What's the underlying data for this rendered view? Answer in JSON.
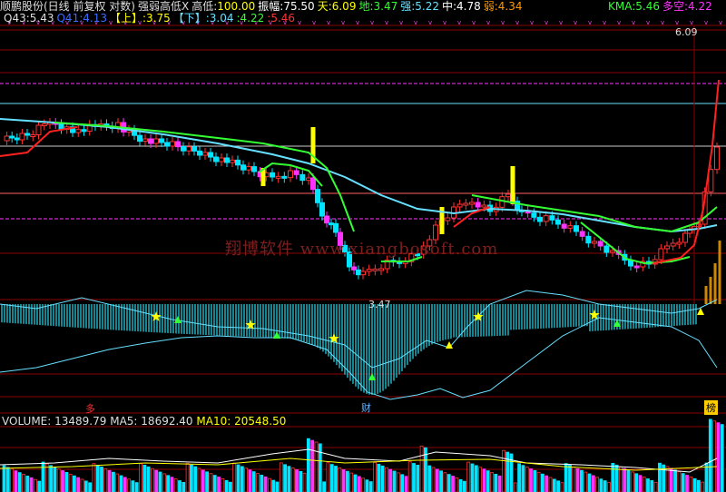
{
  "header1": {
    "name": "顺鹏股份(日线 前复权 对数)",
    "indicator": "强弱高低X",
    "gaodi_label": "高低:",
    "gaodi": "100.00",
    "zhenfu_label": "振幅:",
    "zhenfu": "75.50",
    "tian_label": "天:",
    "tian": "6.09",
    "di_label": "地:",
    "di": "3.47",
    "qiang_label": "强:",
    "qiang": "5.22",
    "zhong_label": "中:",
    "zhong": "4.78",
    "ruo_label": "弱:",
    "ruo": "4.34",
    "kma_label": "KMA:",
    "kma": "5.46",
    "duokong_label": "多空:",
    "duokong": "4.22"
  },
  "header2": {
    "q43_label": "Q43:",
    "q43": "5.43",
    "q41_label": "Q41:",
    "q41": "4.13",
    "up_label": "【上】:",
    "up": "3.75",
    "down_label": "【下】:",
    "down": "3.04",
    "v1_label": ":",
    "v1": "4.22",
    "v2_label": ":",
    "v2": "5.46"
  },
  "price_labels": {
    "high": "6.09",
    "low": "3.47"
  },
  "watermark": "翔博软件 www.xiangbosoft.com",
  "tags": {
    "left": "多",
    "middle": "财",
    "right": "榜"
  },
  "volume_header": {
    "volume_label": "VOLUME:",
    "volume": "13489.79",
    "ma5_label": "MA5:",
    "ma5": "18692.40",
    "ma10_label": "MA10:",
    "ma10": "20548.50"
  },
  "colors": {
    "up": "#ff3232",
    "down": "#00e5ff",
    "magenta": "#ff33ff",
    "yellow": "#ffff00",
    "green_line": "#33ff33",
    "cyan_line": "#66e0ff",
    "red_line": "#ff2020",
    "white_line": "#ffffff",
    "histogram": "#1fb0c0",
    "histogram_green": "#3cc35a",
    "volume_ma5": "#ffffff",
    "volume_ma10": "#ffff00"
  }
}
